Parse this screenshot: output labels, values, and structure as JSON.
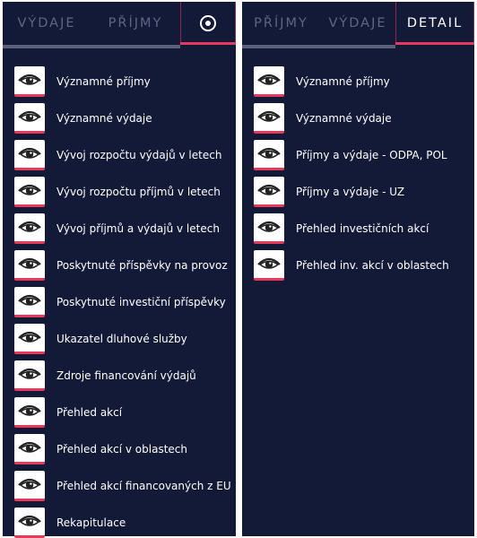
{
  "colors": {
    "panel_bg": "#131a38",
    "accent": "#e8395b",
    "inactive_text": "#5d6586"
  },
  "left_panel": {
    "tabs": [
      {
        "label": "VÝDAJE"
      },
      {
        "label": "PŘÍJMY"
      },
      {
        "icon": "target-icon",
        "active": true
      }
    ],
    "items": [
      {
        "label": "Významné příjmy",
        "icon": "eye-icon"
      },
      {
        "label": "Významné výdaje",
        "icon": "eye-icon"
      },
      {
        "label": "Vývoj rozpočtu výdajů v letech",
        "icon": "eye-icon"
      },
      {
        "label": "Vývoj rozpočtu příjmů v letech",
        "icon": "eye-icon"
      },
      {
        "label": "Vývoj příjmů a výdajů v letech",
        "icon": "eye-icon"
      },
      {
        "label": "Poskytnuté příspěvky na provoz",
        "icon": "eye-icon"
      },
      {
        "label": "Poskytnuté investiční příspěvky",
        "icon": "eye-icon"
      },
      {
        "label": "Ukazatel dluhové služby",
        "icon": "eye-icon"
      },
      {
        "label": "Zdroje financování výdajů",
        "icon": "eye-icon"
      },
      {
        "label": "Přehled akcí",
        "icon": "eye-icon"
      },
      {
        "label": "Přehled akcí v oblastech",
        "icon": "eye-icon"
      },
      {
        "label": "Přehled akcí financovaných z EU",
        "icon": "eye-icon"
      },
      {
        "label": "Rekapitulace",
        "icon": "eye-icon"
      }
    ]
  },
  "right_panel": {
    "tabs": [
      {
        "label": "PŘÍJMY"
      },
      {
        "label": "VÝDAJE"
      },
      {
        "label": "DETAIL",
        "active": true
      }
    ],
    "items": [
      {
        "label": "Významné příjmy",
        "icon": "eye-icon"
      },
      {
        "label": "Významné výdaje",
        "icon": "eye-icon"
      },
      {
        "label": "Příjmy a výdaje - ODPA, POL",
        "icon": "eye-icon"
      },
      {
        "label": "Příjmy a výdaje - UZ",
        "icon": "eye-icon"
      },
      {
        "label": "Přehled investičních akcí",
        "icon": "eye-icon"
      },
      {
        "label": "Přehled inv. akcí v oblastech",
        "icon": "eye-icon"
      }
    ]
  }
}
